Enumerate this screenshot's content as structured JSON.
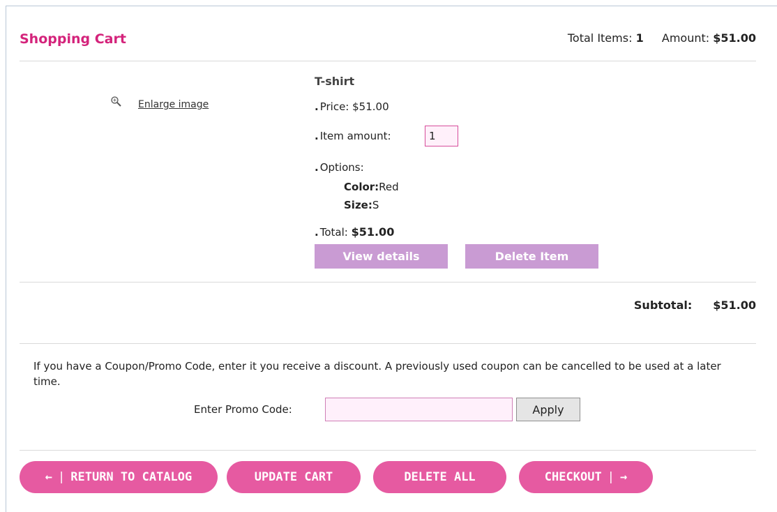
{
  "header": {
    "title": "Shopping Cart",
    "total_items_label": "Total Items:",
    "total_items": "1",
    "amount_label": "Amount:",
    "amount": "$51.00"
  },
  "item": {
    "enlarge_label": "Enlarge image",
    "zoom_icon": "magnifier-icon",
    "name": "T-shirt",
    "price_label": "Price:",
    "price": "$51.00",
    "amount_label": "Item amount:",
    "amount_value": "1",
    "options_label": "Options:",
    "options": [
      {
        "key": "Color:",
        "value": "Red"
      },
      {
        "key": "Size:",
        "value": "S"
      }
    ],
    "total_label": "Total:",
    "total": "$51.00",
    "view_details_label": "View details",
    "delete_item_label": "Delete Item"
  },
  "subtotal": {
    "label": "Subtotal:",
    "value": "$51.00"
  },
  "promo": {
    "text": "If you have a Coupon/Promo Code, enter it you receive a discount. A previously used coupon can be cancelled to be used at a later time.",
    "label": "Enter Promo Code:",
    "value": "",
    "apply_label": "Apply"
  },
  "actions": {
    "return_label": "RETURN TO CATALOG",
    "update_label": "UPDATE CART",
    "delete_all_label": "DELETE ALL",
    "checkout_label": "CHECKOUT",
    "arrow_left": "←",
    "arrow_right": "→",
    "separator": "|"
  },
  "colors": {
    "title": "#d4237b",
    "pill_button": "#e65aa1",
    "item_button": "#c99bd3",
    "input_bg": "#fff0fa"
  }
}
